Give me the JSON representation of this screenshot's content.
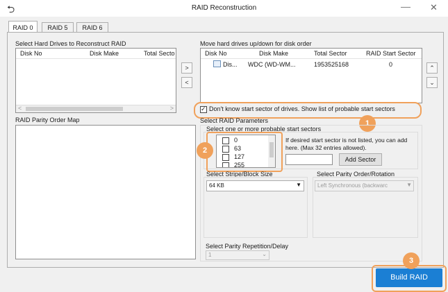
{
  "window": {
    "title": "RAID Reconstruction"
  },
  "tabs": [
    {
      "label": "RAID 0"
    },
    {
      "label": "RAID 5"
    },
    {
      "label": "RAID 6"
    }
  ],
  "left": {
    "select_label": "Select Hard Drives to Reconstruct RAID",
    "columns": [
      "Disk No",
      "Disk Make",
      "Total Secto"
    ],
    "parity_map_label": "RAID Parity Order Map"
  },
  "right": {
    "order_label": "Move hard drives up/down for disk order",
    "columns": [
      "Disk No",
      "Disk Make",
      "Total Sector",
      "RAID Start Sector"
    ],
    "rows": [
      {
        "disk_no": "Dis...",
        "disk_make": "WDC (WD-WM...",
        "total_sector": "1953525168",
        "start_sector": "0"
      }
    ]
  },
  "unknown_start": {
    "label": "Don't know start sector of drives. Show list of probable start sectors",
    "checked": true
  },
  "params": {
    "title": "Select RAID Parameters",
    "sectors_label": "Select one or more probable start sectors",
    "sectors": [
      "0",
      "63",
      "127",
      "255"
    ],
    "hint": "If desired start sector is not listed, you can add here. (Max 32 entries allowed).",
    "add_button": "Add Sector",
    "stripe_label": "Select Stripe/Block Size",
    "stripe_value": "64 KB",
    "parity_order_label": "Select Parity Order/Rotation",
    "parity_order_value": "Left Synchronous (backwarc",
    "repetition_label": "Select Parity Repetition/Delay",
    "repetition_value": "1"
  },
  "buttons": {
    "move_right": ">",
    "move_left": "<",
    "up": "⌃",
    "down": "⌄"
  },
  "callouts": [
    "1",
    "2",
    "3"
  ],
  "build_button": "Build RAID",
  "icons": {
    "back": "back-arrow-icon",
    "minimize": "minimize-icon",
    "close": "close-icon"
  },
  "colors": {
    "accent": "#1b7fd4",
    "callout": "#f0a15b"
  }
}
